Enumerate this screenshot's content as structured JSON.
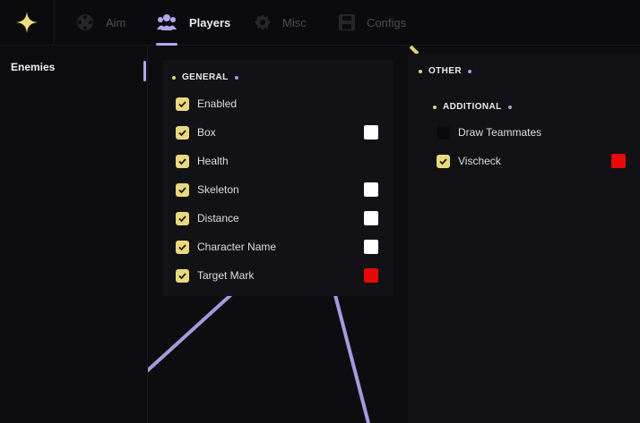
{
  "colors": {
    "accent": "#b3a6ee",
    "checkbox": "#ead97c",
    "swatch_white": "#ffffff",
    "swatch_red": "#e80808"
  },
  "tabs": [
    {
      "label": "Aim",
      "icon": "crosshair-icon",
      "active": false
    },
    {
      "label": "Players",
      "icon": "users-icon",
      "active": true
    },
    {
      "label": "Misc",
      "icon": "gear-icon",
      "active": false
    },
    {
      "label": "Configs",
      "icon": "save-icon",
      "active": false
    }
  ],
  "sidebar": {
    "items": [
      {
        "label": "Enemies",
        "active": true
      }
    ]
  },
  "general": {
    "title": "GENERAL",
    "options": [
      {
        "label": "Enabled",
        "checked": true,
        "color": null
      },
      {
        "label": "Box",
        "checked": true,
        "color": "#ffffff"
      },
      {
        "label": "Health",
        "checked": true,
        "color": null
      },
      {
        "label": "Skeleton",
        "checked": true,
        "color": "#ffffff"
      },
      {
        "label": "Distance",
        "checked": true,
        "color": "#ffffff"
      },
      {
        "label": "Character Name",
        "checked": true,
        "color": "#ffffff"
      },
      {
        "label": "Target Mark",
        "checked": true,
        "color": "#e80808"
      }
    ]
  },
  "other": {
    "title": "OTHER",
    "additional": {
      "title": "ADDITIONAL",
      "options": [
        {
          "label": "Draw Teammates",
          "checked": false,
          "color": null
        },
        {
          "label": "Vischeck",
          "checked": true,
          "color": "#e80808"
        }
      ]
    }
  }
}
